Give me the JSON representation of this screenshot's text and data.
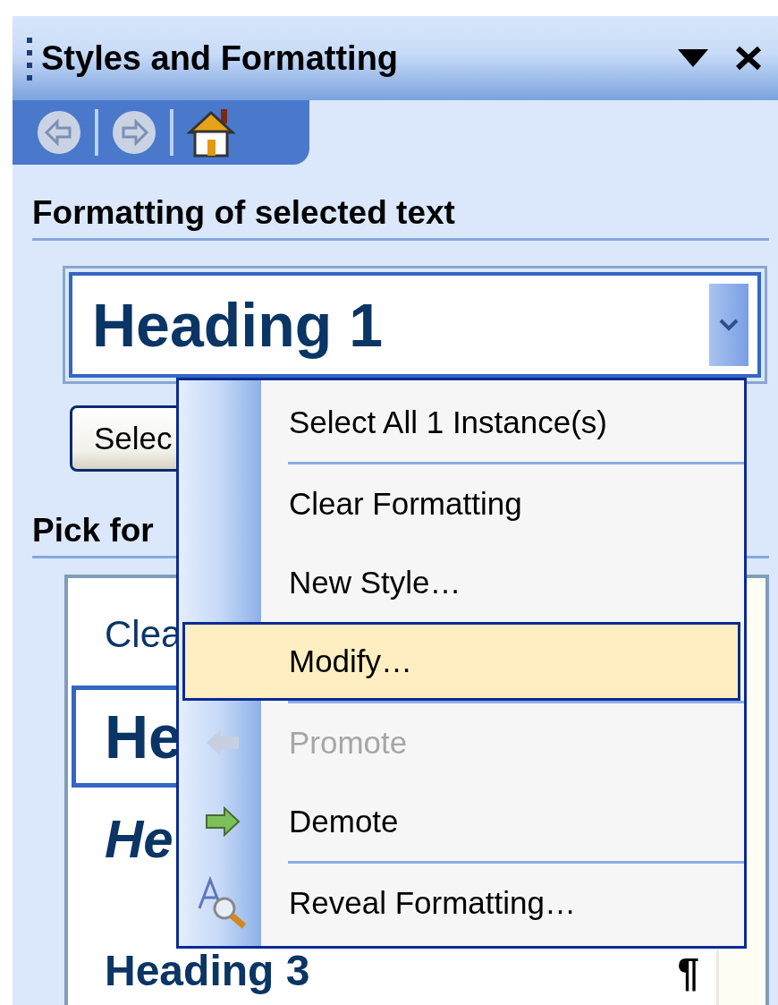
{
  "panel": {
    "title": "Styles and Formatting",
    "nav": [
      {
        "kind": "back",
        "disabled": true
      },
      {
        "kind": "forward",
        "disabled": true
      },
      {
        "kind": "home",
        "disabled": false
      }
    ]
  },
  "formatting_section": {
    "heading": "Formatting of selected text",
    "style_box": {
      "value": "Heading 1"
    },
    "select_button": "Selec"
  },
  "pick_section": {
    "heading": "Pick for",
    "styles": [
      {
        "label": "Clea",
        "kind": "plain",
        "selected": false
      },
      {
        "label": "He",
        "kind": "heading1",
        "selected": true
      },
      {
        "label": "He",
        "kind": "heading2",
        "selected": false
      },
      {
        "label": "Heading 3",
        "kind": "heading3",
        "selected": false,
        "mark": "¶"
      }
    ]
  },
  "context_menu": {
    "items": [
      {
        "kind": "item",
        "label": "Select All 1 Instance(s)",
        "selected": false,
        "disabled": false
      },
      {
        "kind": "separator"
      },
      {
        "kind": "item",
        "label": "Clear Formatting",
        "selected": false,
        "disabled": false
      },
      {
        "kind": "item",
        "label": "New Style…",
        "selected": false,
        "disabled": false
      },
      {
        "kind": "item",
        "label": "Modify…",
        "selected": true,
        "disabled": false
      },
      {
        "kind": "separator"
      },
      {
        "kind": "promote",
        "label": "Promote",
        "selected": false,
        "disabled": true
      },
      {
        "kind": "demote",
        "label": "Demote",
        "selected": false,
        "disabled": false
      },
      {
        "kind": "separator"
      },
      {
        "kind": "reveal",
        "label": "Reveal Formatting…",
        "selected": false,
        "disabled": false
      }
    ]
  }
}
